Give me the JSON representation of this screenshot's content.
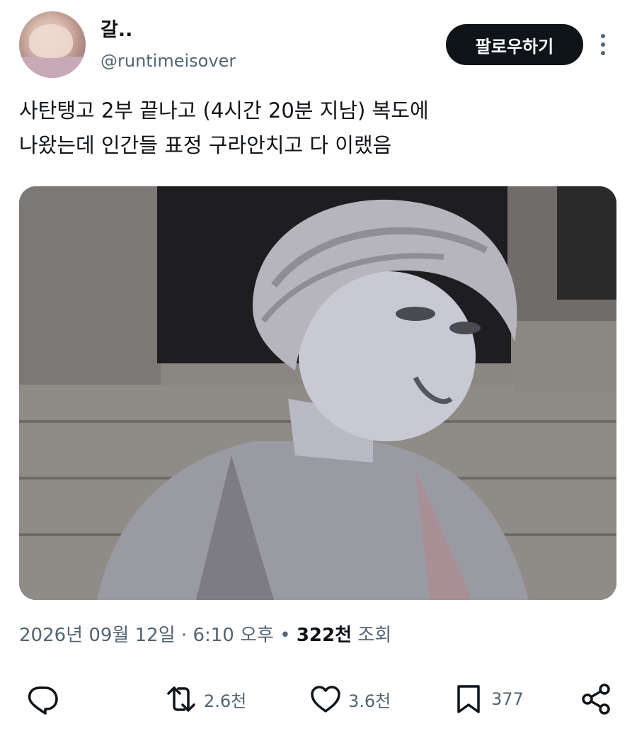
{
  "author": {
    "display_name": "갈..",
    "handle": "@runtimeisover"
  },
  "header": {
    "follow_label": "팔로우하기",
    "more_icon": "more-vertical-icon"
  },
  "tweet": {
    "text": "사탄탱고 2부 끝나고 (4시간 20분 지남) 복도에\n나왔는데 인간들 표정 구라안치고 다 이랬음",
    "media_description_icon": "statue-photo"
  },
  "meta": {
    "date": "2026년 09월 12일",
    "separator": "·",
    "time": "6:10 오후",
    "dot": "•",
    "views_count": "322천",
    "views_label": "조회"
  },
  "actions": {
    "reply": {
      "icon": "reply-icon",
      "count": ""
    },
    "retweet": {
      "icon": "retweet-icon",
      "count": "2.6천"
    },
    "like": {
      "icon": "heart-icon",
      "count": "3.6천"
    },
    "bookmark": {
      "icon": "bookmark-icon",
      "count": "377"
    },
    "share": {
      "icon": "share-icon",
      "count": ""
    }
  },
  "colors": {
    "text": "#0f1419",
    "secondary": "#536471",
    "button_bg": "#0f1419"
  }
}
